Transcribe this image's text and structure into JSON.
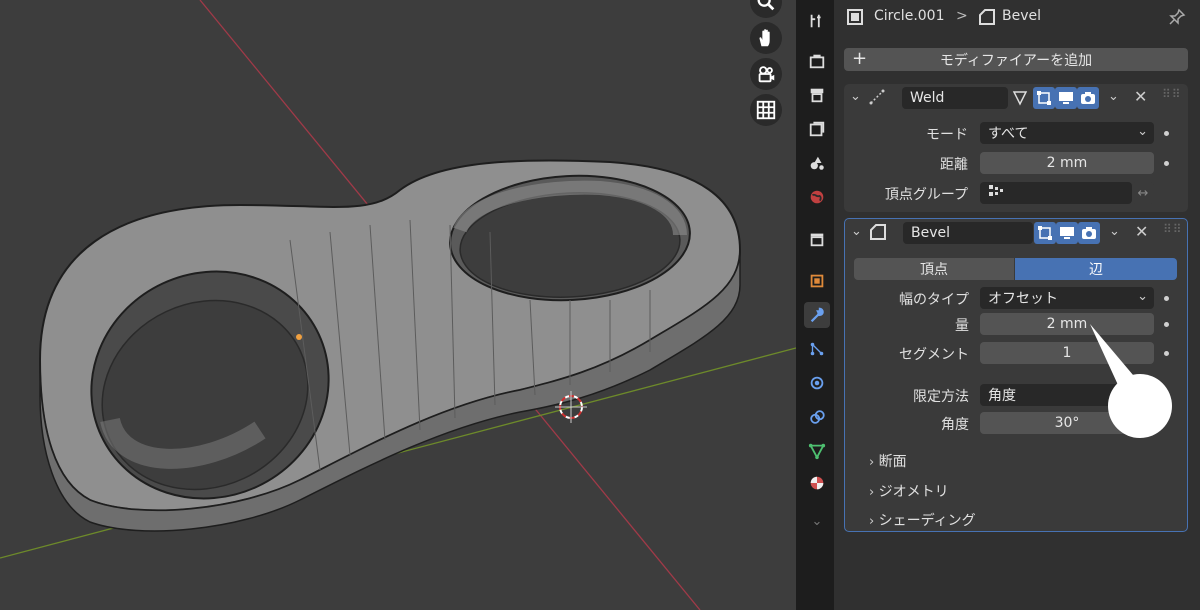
{
  "viewport": {
    "nav_icons": [
      "zoom-icon",
      "hand-pan-icon",
      "camera-icon",
      "grid-icon"
    ]
  },
  "sidebar_tabs": [
    "tool-icon",
    "render-icon",
    "output-icon",
    "view-layer-icon",
    "scene-icon",
    "world-icon",
    "collection-icon",
    "object-icon",
    "modifier-icon",
    "particles-icon",
    "physics-icon",
    "constraints-icon",
    "data-icon",
    "material-icon"
  ],
  "header": {
    "object_name": "Circle.001",
    "separator": ">",
    "modifier_name": "Bevel"
  },
  "add_modifier_label": "モディファイアーを追加",
  "weld": {
    "name": "Weld",
    "mode_label": "モード",
    "mode_value": "すべて",
    "distance_label": "距離",
    "distance_value": "2 mm",
    "vgroup_label": "頂点グループ",
    "vgroup_value": ""
  },
  "bevel": {
    "name": "Bevel",
    "tab_vertices": "頂点",
    "tab_edges": "辺",
    "width_type_label": "幅のタイプ",
    "width_type_value": "オフセット",
    "amount_label": "量",
    "amount_value": "2 mm",
    "segments_label": "セグメント",
    "segments_value": "1",
    "limit_method_label": "限定方法",
    "limit_method_value": "角度",
    "angle_label": "角度",
    "angle_value": "30°",
    "sections": [
      "断面",
      "ジオメトリ",
      "シェーディング"
    ]
  },
  "colors": {
    "accent": "#4772b3",
    "panel_bg": "#303030",
    "viewport_bg": "#3d3d3d",
    "x_axis": "#a03a48",
    "y_axis": "#6d8a2a"
  }
}
